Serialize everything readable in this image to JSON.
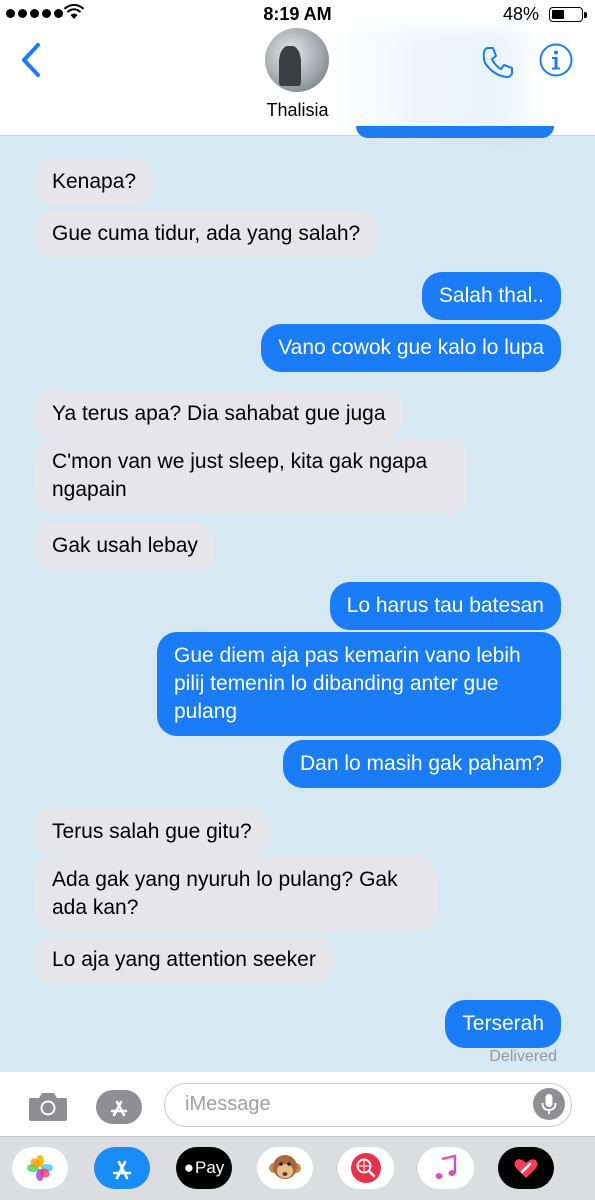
{
  "status_bar": {
    "time": "8:19 AM",
    "battery": "48%",
    "battery_level": 0.48
  },
  "header": {
    "contact_name": "Thalisia",
    "icons": [
      "back-chevron-icon",
      "phone-icon",
      "info-icon"
    ]
  },
  "messages": [
    {
      "dir": "in",
      "text": "Kenapa?"
    },
    {
      "dir": "in",
      "text": "Gue cuma tidur, ada yang salah?"
    },
    {
      "dir": "out",
      "text": "Salah thal.."
    },
    {
      "dir": "out",
      "text": "Vano cowok gue kalo lo lupa"
    },
    {
      "dir": "in",
      "text": "Ya terus apa? Dia sahabat gue juga"
    },
    {
      "dir": "in",
      "text": "C'mon van we just sleep, kita gak ngapa ngapain"
    },
    {
      "dir": "in",
      "text": "Gak usah lebay"
    },
    {
      "dir": "out",
      "text": "Lo harus tau batesan"
    },
    {
      "dir": "out",
      "text": "Gue diem aja pas kemarin vano lebih pilij temenin lo dibanding anter gue pulang"
    },
    {
      "dir": "out",
      "text": "Dan lo masih gak paham?"
    },
    {
      "dir": "in",
      "text": "Terus salah gue gitu?"
    },
    {
      "dir": "in",
      "text": "Ada gak yang nyuruh lo pulang? Gak ada kan?"
    },
    {
      "dir": "in",
      "text": "Lo aja yang attention seeker"
    },
    {
      "dir": "out",
      "text": "Terserah"
    }
  ],
  "delivery_status": "Delivered",
  "input": {
    "placeholder": "iMessage"
  },
  "app_drawer": {
    "apps": [
      "photos-icon",
      "app-store-icon",
      "apple-pay-icon",
      "monkey-animoji-icon",
      "web-search-icon",
      "music-icon",
      "heart-digital-touch-icon"
    ],
    "apple_pay_label": "Pay"
  },
  "colors": {
    "background": "#d6e8f1",
    "outgoing_bubble": "#1a7cf6",
    "incoming_bubble": "#e5e5ea",
    "accent": "#1a7cf6"
  }
}
